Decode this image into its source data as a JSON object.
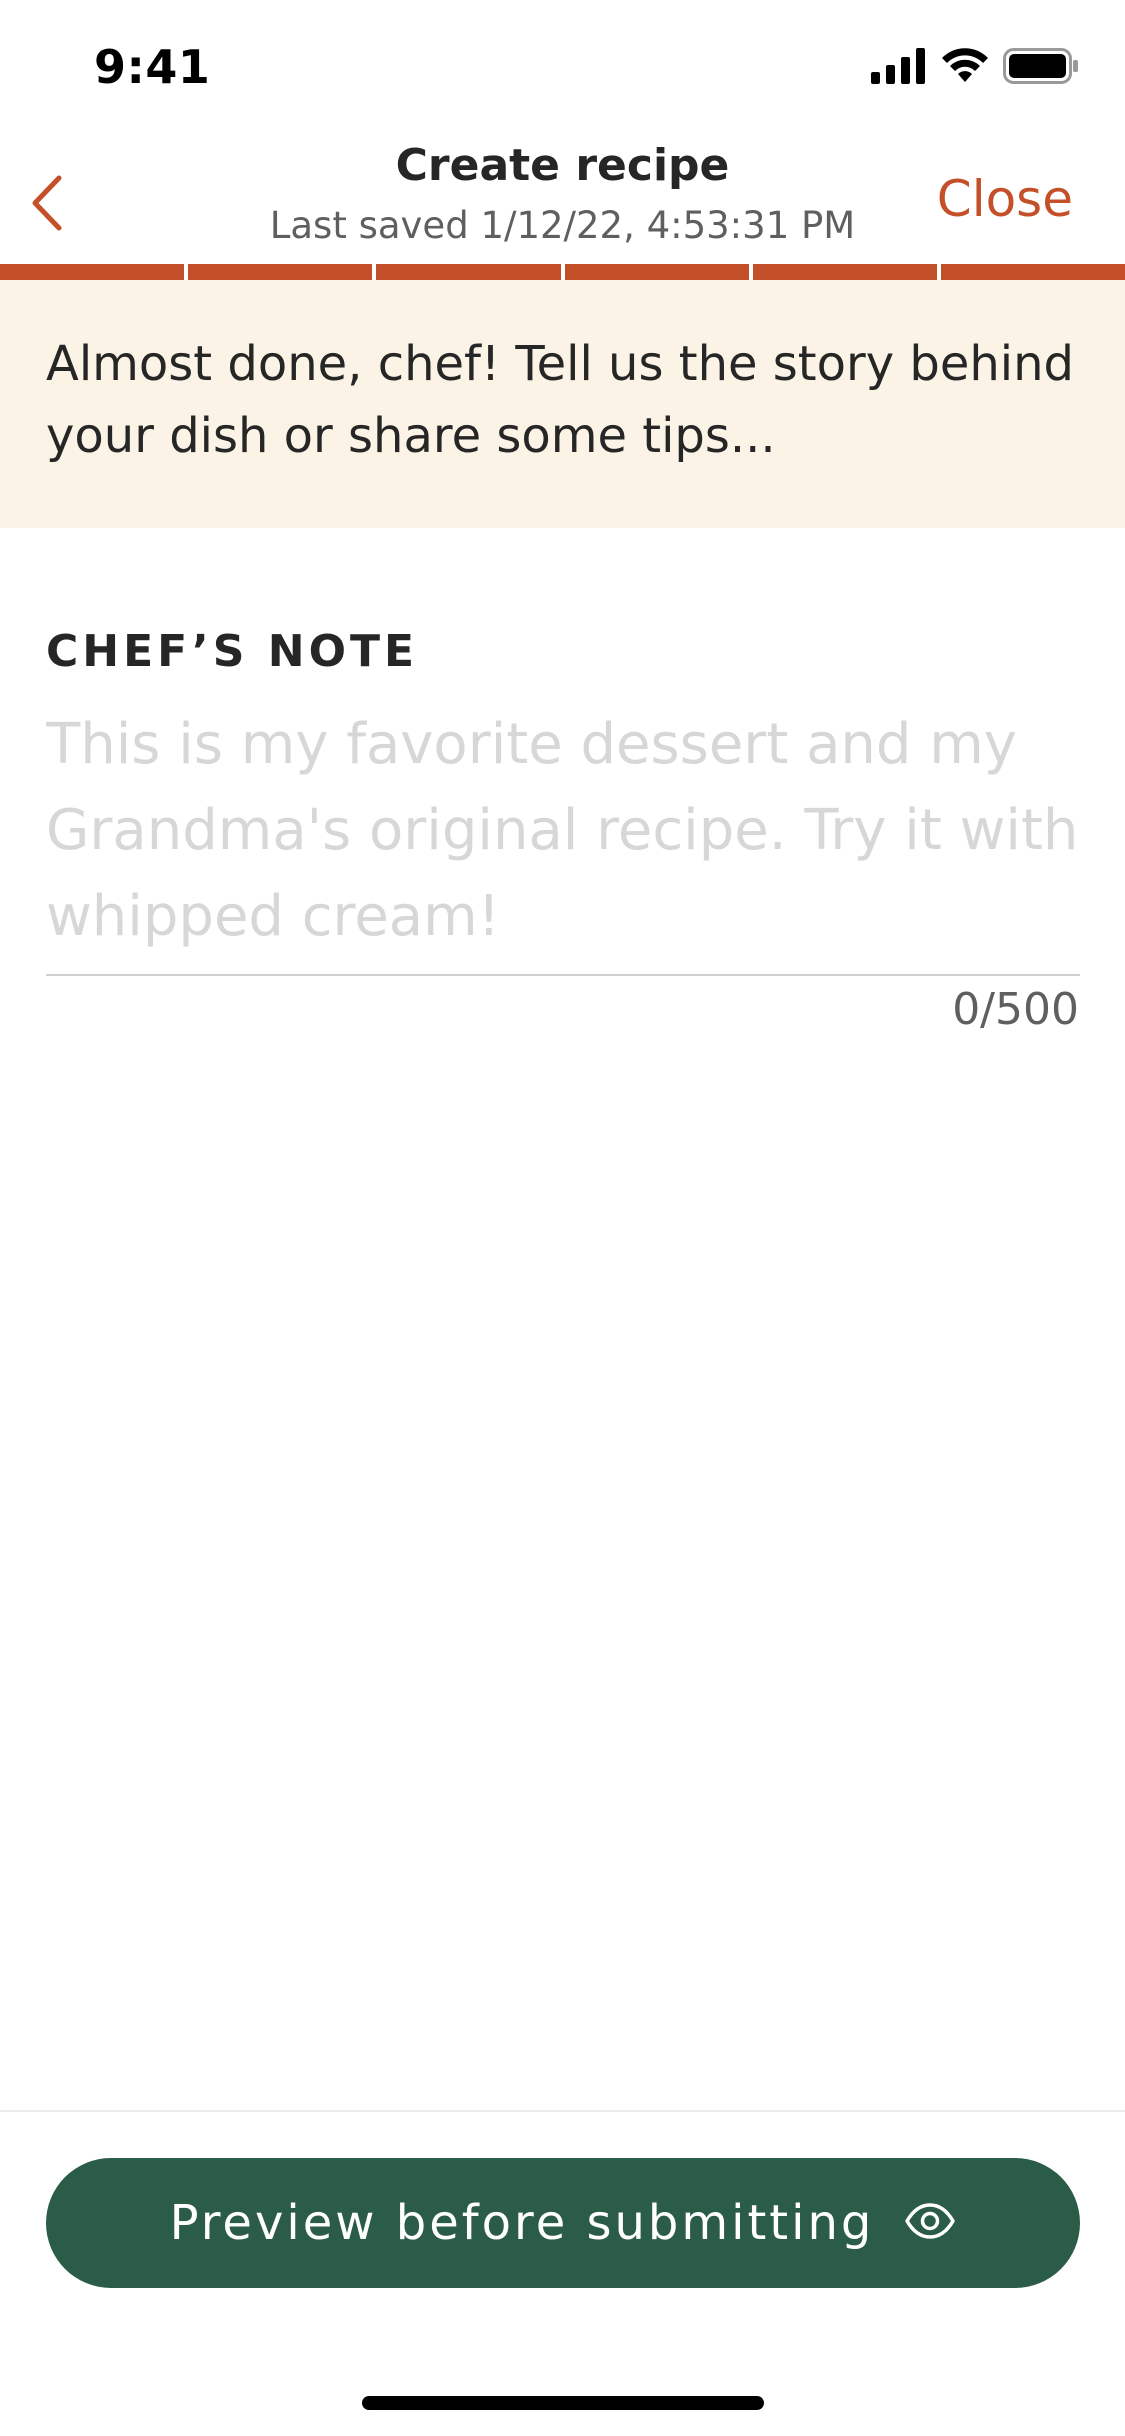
{
  "status_bar": {
    "time": "9:41"
  },
  "header": {
    "title": "Create recipe",
    "subtitle": "Last saved 1/12/22, 4:53:31 PM",
    "close_label": "Close",
    "back_icon": "chevron-left-icon"
  },
  "progress": {
    "total_steps": 6,
    "completed_steps": 6,
    "active_color": "#c4502a"
  },
  "banner": {
    "text": "Almost done, chef! Tell us the story behind your dish or share some tips..."
  },
  "chef_note": {
    "label": "CHEF’S NOTE",
    "value": "",
    "placeholder": "This is my favorite dessert and my Grandma's original recipe. Try it with whipped cream!",
    "char_count": "0/500"
  },
  "footer": {
    "preview_label": "Preview before submitting",
    "preview_icon": "eye-icon",
    "button_color": "#2b5c48"
  },
  "colors": {
    "accent": "#c4502a",
    "banner_bg": "#fbf4e6",
    "primary_button": "#2b5c48"
  }
}
